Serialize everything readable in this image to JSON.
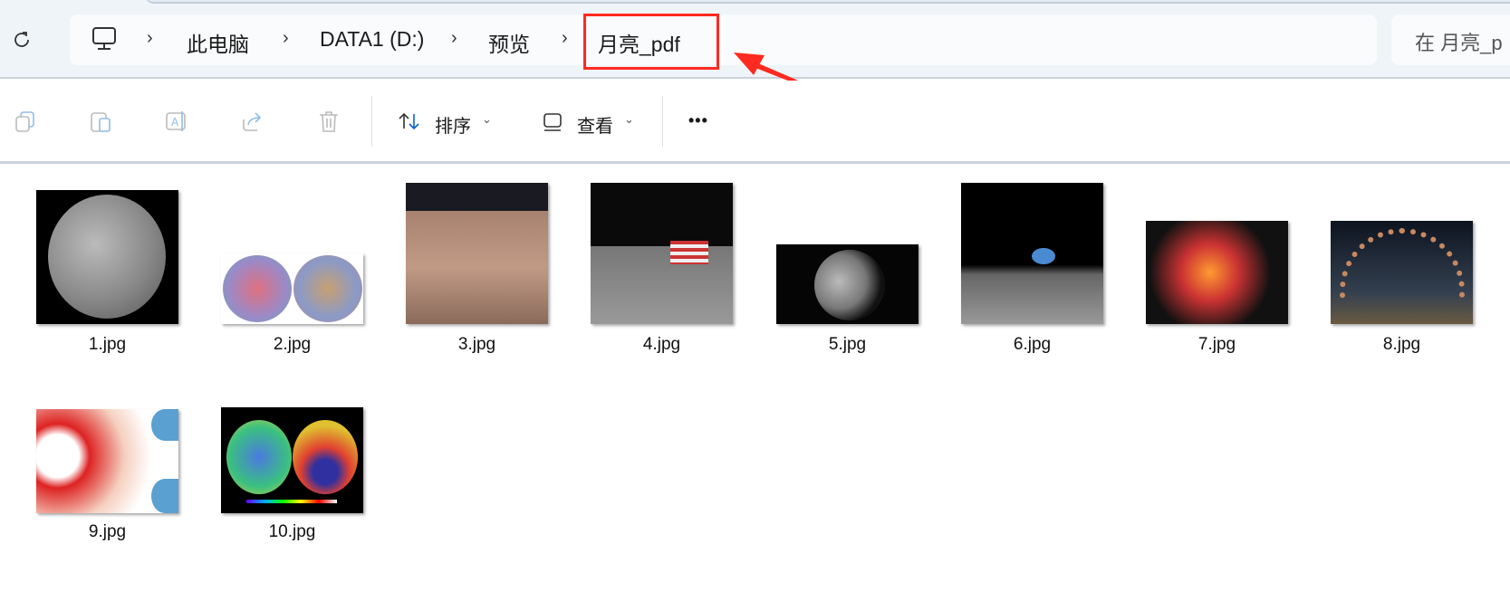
{
  "nav": {
    "refresh_icon": "refresh-icon"
  },
  "breadcrumb": {
    "items": [
      "此电脑",
      "DATA1 (D:)",
      "预览",
      "月亮_pdf"
    ],
    "root_icon": "computer-icon"
  },
  "search": {
    "placeholder": "在 月亮_p"
  },
  "toolbar": {
    "sort_label": "排序",
    "view_label": "查看",
    "more_label": "•••",
    "icons": [
      "copy-icon",
      "paste-icon",
      "rename-icon",
      "share-icon",
      "delete-icon"
    ]
  },
  "files": [
    {
      "name": "1.jpg"
    },
    {
      "name": "2.jpg"
    },
    {
      "name": "3.jpg"
    },
    {
      "name": "4.jpg"
    },
    {
      "name": "5.jpg"
    },
    {
      "name": "6.jpg"
    },
    {
      "name": "7.jpg"
    },
    {
      "name": "8.jpg"
    },
    {
      "name": "9.jpg"
    },
    {
      "name": "10.jpg"
    }
  ],
  "colors": {
    "highlight": "#ff2a1f",
    "accent": "#0a64c8"
  }
}
